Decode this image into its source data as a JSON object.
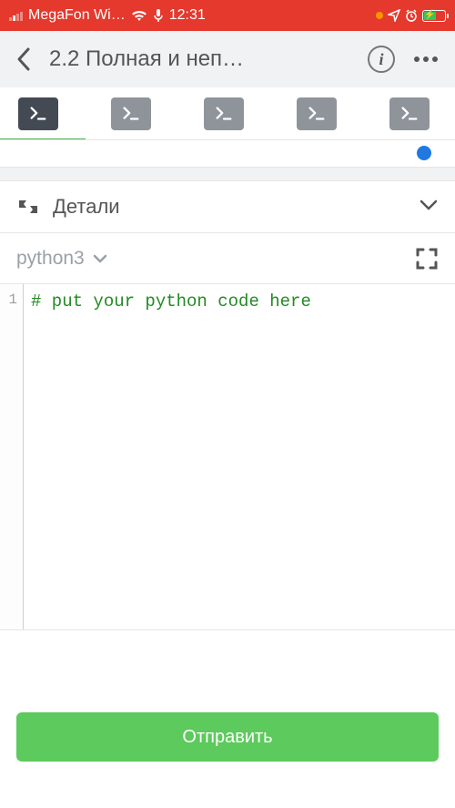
{
  "status": {
    "carrier": "MegaFon Wi…",
    "time": "12:31"
  },
  "header": {
    "title": "2.2 Полная и неп…"
  },
  "details": {
    "label": "Детали"
  },
  "language": {
    "selected": "python3"
  },
  "editor": {
    "line_numbers": [
      "1"
    ],
    "code": "# put your python code here"
  },
  "submit": {
    "label": "Отправить"
  }
}
